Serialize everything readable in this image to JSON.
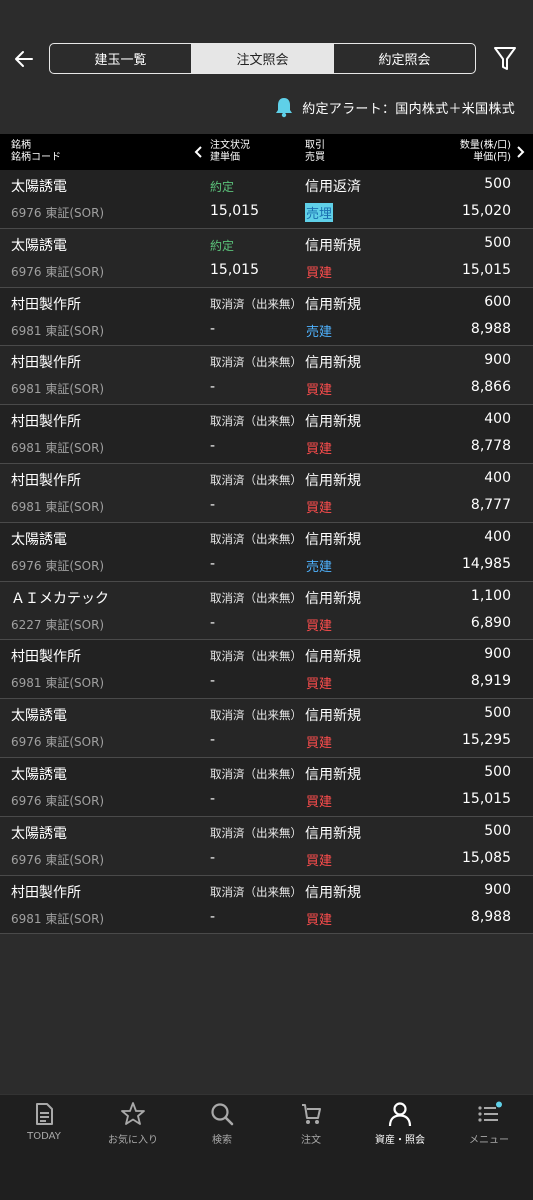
{
  "header": {
    "tabs": [
      {
        "label": "建玉一覧",
        "active": false
      },
      {
        "label": "注文照会",
        "active": true
      },
      {
        "label": "約定照会",
        "active": false
      }
    ]
  },
  "alert": {
    "text": "約定アラート：国内株式＋米国株式"
  },
  "columns": {
    "name1": "銘柄",
    "name2": "銘柄コード",
    "status1": "注文状況",
    "status2": "建単価",
    "trade1": "取引",
    "trade2": "売買",
    "qty1": "数量(株/口)",
    "qty2": "単価(円)"
  },
  "rows": [
    {
      "name": "太陽誘電",
      "code": "6976 東証(SOR)",
      "status": "約定",
      "price": "15,015",
      "trade": "信用返済",
      "side": "売埋",
      "qty": "500",
      "unit": "15,020"
    },
    {
      "name": "太陽誘電",
      "code": "6976 東証(SOR)",
      "status": "約定",
      "price": "15,015",
      "trade": "信用新規",
      "side": "買建",
      "qty": "500",
      "unit": "15,015"
    },
    {
      "name": "村田製作所",
      "code": "6981 東証(SOR)",
      "status": "取消済（出来無）",
      "price": "-",
      "trade": "信用新規",
      "side": "売建",
      "qty": "600",
      "unit": "8,988"
    },
    {
      "name": "村田製作所",
      "code": "6981 東証(SOR)",
      "status": "取消済（出来無）",
      "price": "-",
      "trade": "信用新規",
      "side": "買建",
      "qty": "900",
      "unit": "8,866"
    },
    {
      "name": "村田製作所",
      "code": "6981 東証(SOR)",
      "status": "取消済（出来無）",
      "price": "-",
      "trade": "信用新規",
      "side": "買建",
      "qty": "400",
      "unit": "8,778"
    },
    {
      "name": "村田製作所",
      "code": "6981 東証(SOR)",
      "status": "取消済（出来無）",
      "price": "-",
      "trade": "信用新規",
      "side": "買建",
      "qty": "400",
      "unit": "8,777"
    },
    {
      "name": "太陽誘電",
      "code": "6976 東証(SOR)",
      "status": "取消済（出来無）",
      "price": "-",
      "trade": "信用新規",
      "side": "売建",
      "qty": "400",
      "unit": "14,985"
    },
    {
      "name": "ＡＩメカテック",
      "code": "6227 東証(SOR)",
      "status": "取消済（出来無）",
      "price": "-",
      "trade": "信用新規",
      "side": "買建",
      "qty": "1,100",
      "unit": "6,890"
    },
    {
      "name": "村田製作所",
      "code": "6981 東証(SOR)",
      "status": "取消済（出来無）",
      "price": "-",
      "trade": "信用新規",
      "side": "買建",
      "qty": "900",
      "unit": "8,919"
    },
    {
      "name": "太陽誘電",
      "code": "6976 東証(SOR)",
      "status": "取消済（出来無）",
      "price": "-",
      "trade": "信用新規",
      "side": "買建",
      "qty": "500",
      "unit": "15,295"
    },
    {
      "name": "太陽誘電",
      "code": "6976 東証(SOR)",
      "status": "取消済（出来無）",
      "price": "-",
      "trade": "信用新規",
      "side": "買建",
      "qty": "500",
      "unit": "15,015"
    },
    {
      "name": "太陽誘電",
      "code": "6976 東証(SOR)",
      "status": "取消済（出来無）",
      "price": "-",
      "trade": "信用新規",
      "side": "買建",
      "qty": "500",
      "unit": "15,085"
    },
    {
      "name": "村田製作所",
      "code": "6981 東証(SOR)",
      "status": "取消済（出来無）",
      "price": "-",
      "trade": "信用新規",
      "side": "買建",
      "qty": "900",
      "unit": "8,988"
    }
  ],
  "nav": [
    {
      "label": "TODAY",
      "icon": "today-icon",
      "active": false
    },
    {
      "label": "お気に入り",
      "icon": "star-icon",
      "active": false
    },
    {
      "label": "検索",
      "icon": "search-icon",
      "active": false
    },
    {
      "label": "注文",
      "icon": "cart-icon",
      "active": false
    },
    {
      "label": "資産・照会",
      "icon": "person-icon",
      "active": true
    },
    {
      "label": "メニュー",
      "icon": "menu-icon",
      "active": false
    }
  ],
  "colors": {
    "buy": "#ff4d4d",
    "sell": "#4fb3ff",
    "filled": "#5bc27a",
    "accent": "#5fd0e8"
  }
}
